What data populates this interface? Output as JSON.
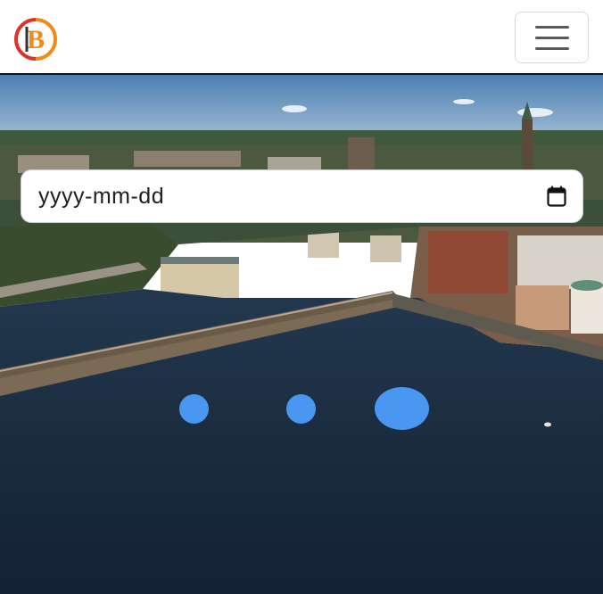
{
  "navbar": {
    "logo": {
      "icon": "b-logo-icon",
      "letter": "B"
    },
    "menu_button": {
      "icon": "hamburger-menu-icon"
    }
  },
  "hero": {
    "image": "aerial-city-waterfront-photo"
  },
  "date_input": {
    "placeholder": "yyyy-mm-dd",
    "icon": "calendar-icon"
  },
  "colors": {
    "accent_dots": "#4a97f2",
    "logo_orange": "#f08a1c",
    "logo_red": "#e0302a"
  },
  "carousel": {
    "dots_count": 3,
    "active_index": 2
  }
}
